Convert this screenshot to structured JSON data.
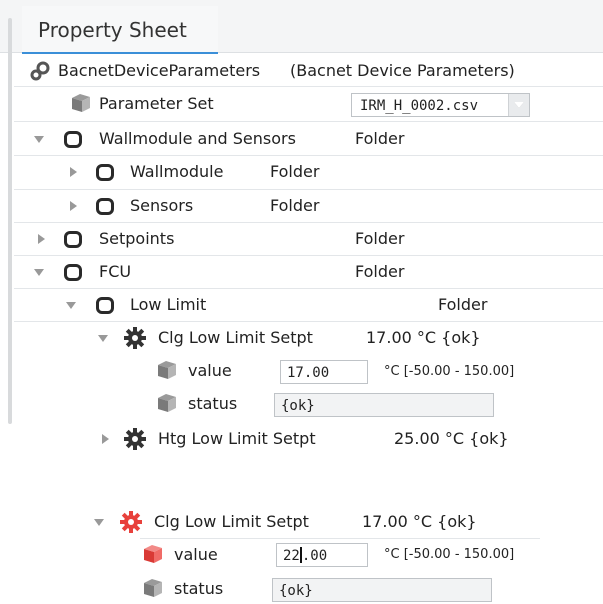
{
  "tab": {
    "label": "Property Sheet"
  },
  "root": {
    "name": "BacnetDeviceParameters",
    "type": "(Bacnet Device Parameters)"
  },
  "parameter_set": {
    "label": "Parameter Set",
    "value": "IRM_H_0002.csv"
  },
  "wallmodule_sensors": {
    "label": "Wallmodule and Sensors",
    "value": "Folder"
  },
  "wallmodule": {
    "label": "Wallmodule",
    "value": "Folder"
  },
  "sensors": {
    "label": "Sensors",
    "value": "Folder"
  },
  "setpoints": {
    "label": "Setpoints",
    "value": "Folder"
  },
  "fcu": {
    "label": "FCU",
    "value": "Folder"
  },
  "low_limit": {
    "label": "Low Limit",
    "value": "Folder"
  },
  "clg_low": {
    "label": "Clg Low Limit Setpt",
    "value": "17.00 °C {ok}",
    "value_label": "value",
    "value_field": "17.00",
    "range": "°C [-50.00 - 150.00]",
    "status_label": "status",
    "status_field": "{ok}"
  },
  "htg_low": {
    "label": "Htg Low Limit Setpt",
    "value": "25.00 °C {ok}"
  },
  "clg_low_edit": {
    "label": "Clg Low Limit Setpt",
    "value": "17.00 °C {ok}",
    "value_label": "value",
    "value_field_before": "22",
    "value_field_after": ".00",
    "range": "°C [-50.00 - 150.00]",
    "status_label": "status",
    "status_field": "{ok}"
  },
  "colors": {
    "accent": "#3b8fd8",
    "modified": "#e8413c",
    "icon": "#2a2a2a"
  }
}
